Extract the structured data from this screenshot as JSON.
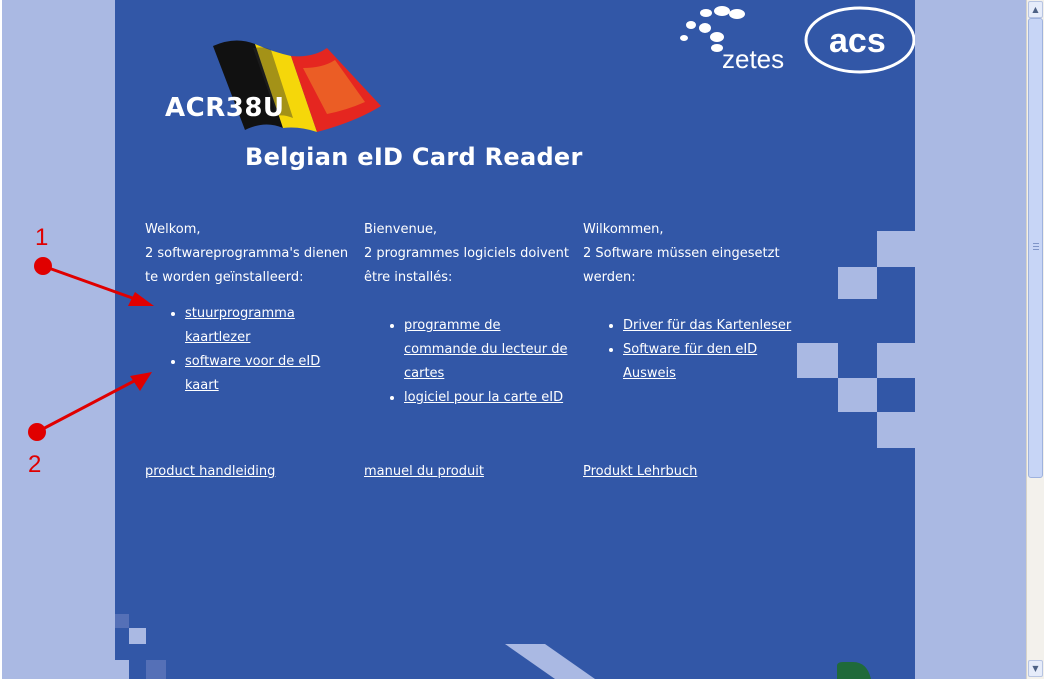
{
  "header": {
    "model": "ACR38U",
    "title": "Belgian eID Card Reader",
    "logos": {
      "zetes": "zetes",
      "acs": "acs"
    }
  },
  "columns": [
    {
      "lang": "nl",
      "intro": [
        "Welkom,",
        "2 softwareprogramma's dienen",
        "te worden geïnstalleerd:"
      ],
      "links": [
        "stuurprogramma kaartlezer",
        "software voor de eID kaart"
      ],
      "manual": "product handleiding"
    },
    {
      "lang": "fr",
      "intro": [
        "Bienvenue,",
        "2 programmes logiciels doivent",
        "être installés:"
      ],
      "links": [
        "programme de commande du lecteur de cartes",
        "logiciel pour la carte eID"
      ],
      "manual": "manuel du produit"
    },
    {
      "lang": "de",
      "intro": [
        "Wilkommen,",
        "2 Software müssen eingesetzt",
        "werden:"
      ],
      "links": [
        "Driver für das Kartenleser",
        "Software für den eID Ausweis"
      ],
      "manual": "Produkt Lehrbuch"
    }
  ],
  "annotations": {
    "one": "1",
    "two": "2"
  },
  "colors": {
    "panel": "#3257a7",
    "background": "#aab9e3",
    "annotation": "#e00000"
  },
  "icons": [
    "belgian-flag-icon",
    "zetes-logo",
    "acs-logo",
    "scroll-up-icon",
    "scroll-down-icon"
  ]
}
